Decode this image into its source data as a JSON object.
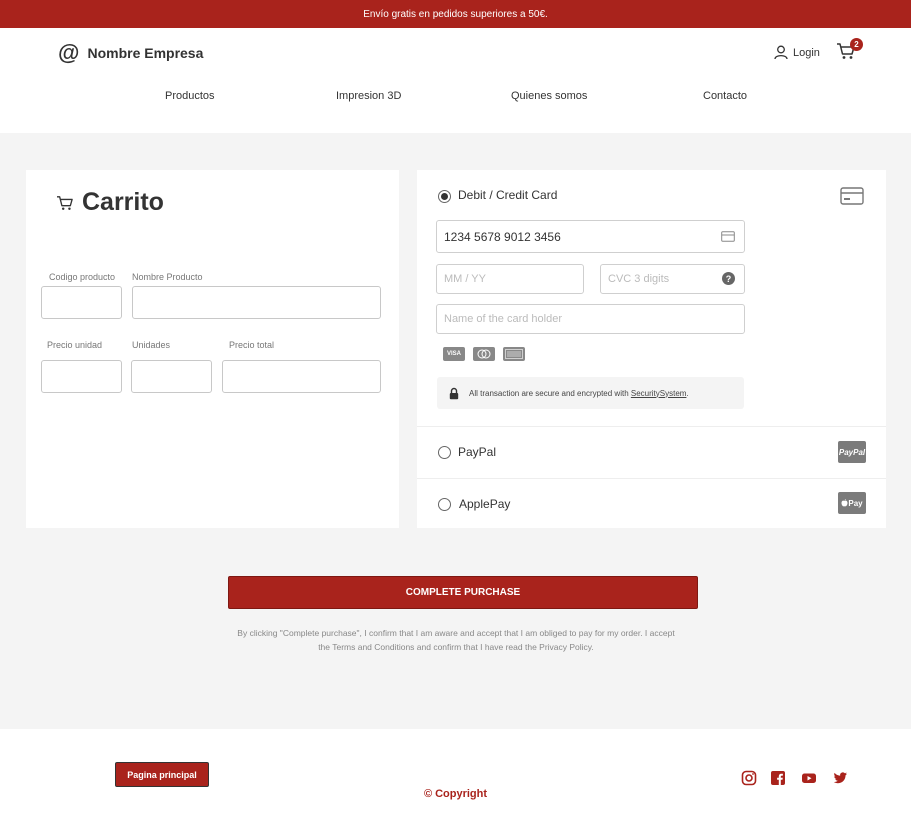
{
  "topbar": {
    "text": "Envío gratis en pedidos superiores a 50€."
  },
  "header": {
    "brand_symbol": "@",
    "brand_name": "Nombre Empresa",
    "login_label": "Login",
    "cart_count": "2",
    "nav": [
      "Productos",
      "Impresion 3D",
      "Quienes somos",
      "Contacto"
    ]
  },
  "cart": {
    "title": "Carrito",
    "labels": {
      "product_code": "Codigo producto",
      "product_name": "Nombre Producto",
      "unit_price": "Precio unidad",
      "units": "Unidades",
      "total_price": "Precio total"
    }
  },
  "payment": {
    "card_option": "Debit / Credit Card",
    "card_number": "1234 5678 9012 3456",
    "expiry_placeholder": "MM / YY",
    "cvc_placeholder": "CVC 3 digits",
    "holder_placeholder": "Name of the card holder",
    "card_logos": [
      "VISA",
      "MC",
      "AMEX"
    ],
    "secure_text": "All transaction are secure and encrypted with",
    "secure_link": "SecuritySystem",
    "secure_end": ".",
    "paypal_option": "PayPal",
    "paypal_badge": "PayPal",
    "applepay_option": "ApplePay",
    "applepay_badge": "Pay"
  },
  "actions": {
    "complete_label": "COMPLETE PURCHASE",
    "legal_text": "By clicking \"Complete purchase\", I confirm that I am aware and accept that I am obliged to pay for my order. I accept the Terms and Conditions and confirm that I have read the Privacy Policy."
  },
  "footer": {
    "home_label": "Pagina principal",
    "copyright": "© Copyright",
    "social_icons": [
      "instagram-icon",
      "facebook-icon",
      "youtube-icon",
      "twitter-icon"
    ]
  },
  "colors": {
    "accent": "#a9231c",
    "background": "#f4f4f4"
  }
}
